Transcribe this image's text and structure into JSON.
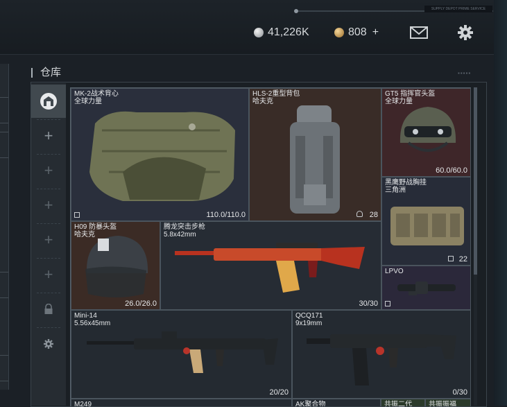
{
  "top_tag": "SUPPLY DEPOT PRIME SERVICE",
  "currency": {
    "silver": "41,226K",
    "gold": "808",
    "gold_plus": "+"
  },
  "section": {
    "title": "仓库",
    "dots": "▪▪▪▪▪"
  },
  "sidebar": {
    "items": [
      {
        "icon": "warehouse-icon",
        "glyph": "⌂"
      },
      {
        "icon": "plus-icon",
        "glyph": "+"
      },
      {
        "icon": "plus-icon",
        "glyph": "+"
      },
      {
        "icon": "plus-icon",
        "glyph": "+"
      },
      {
        "icon": "plus-icon",
        "glyph": "+"
      },
      {
        "icon": "plus-icon",
        "glyph": "+"
      },
      {
        "icon": "lock-icon",
        "glyph": "🔒"
      },
      {
        "icon": "gear-icon",
        "glyph": "⚙"
      }
    ]
  },
  "items": [
    {
      "name": "MK-2战术背心",
      "sub": "全球力量",
      "value": "110.0/110.0"
    },
    {
      "name": "HLS-2重型背包",
      "sub": "哈夫克",
      "value": "28"
    },
    {
      "name": "GT5 指挥官头盔",
      "sub": "全球力量",
      "value": "60.0/60.0"
    },
    {
      "name": "黑鹰野战胸挂",
      "sub": "三角洲",
      "value": "22"
    },
    {
      "name": "H09 防暴头盔",
      "sub": "哈夫克",
      "value": "26.0/26.0"
    },
    {
      "name": "腾龙突击步枪",
      "sub": "5.8x42mm",
      "value": "30/30"
    },
    {
      "name": "LPVO",
      "sub": "",
      "value": ""
    },
    {
      "name": "Mini-14",
      "sub": "5.56x45mm",
      "value": "20/20"
    },
    {
      "name": "QCQ171",
      "sub": "9x19mm",
      "value": "0/30"
    },
    {
      "name": "M249",
      "sub": "",
      "value": ""
    },
    {
      "name": "AK聚合物",
      "sub": "",
      "value": ""
    },
    {
      "name": "共振二代",
      "sub": "",
      "value": ""
    },
    {
      "name": "共振振福",
      "sub": "",
      "value": ""
    }
  ],
  "colors": {
    "cell_dark": "#262d35",
    "cell_brown": "#3a2b25",
    "cell_red": "#3d2528",
    "cell_blue": "#262b3e",
    "cell_purple": "#2e2a3a"
  }
}
